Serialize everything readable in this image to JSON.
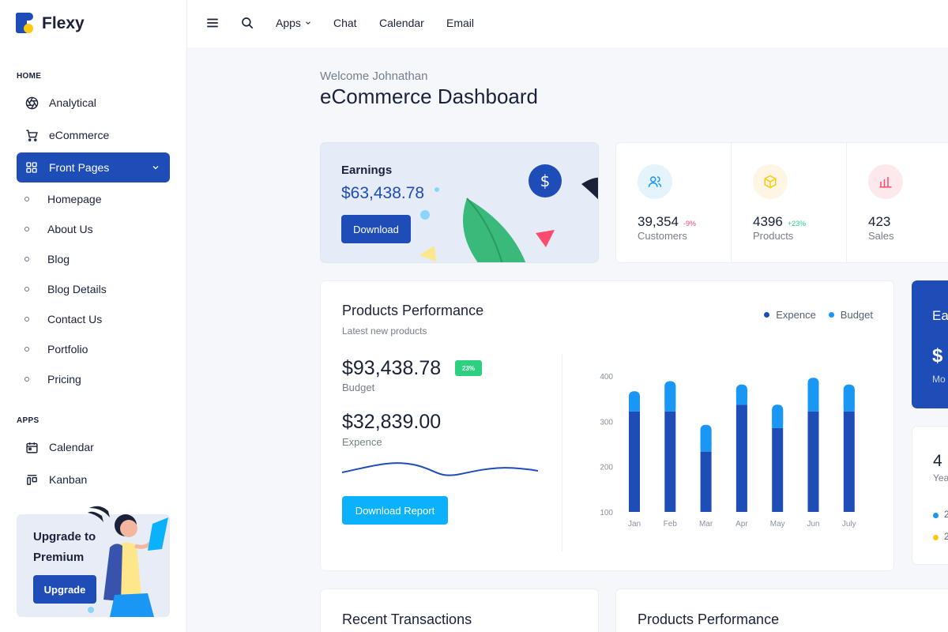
{
  "brand": {
    "name": "Flexy"
  },
  "sidebar": {
    "home_caption": "HOME",
    "apps_caption": "APPS",
    "items": [
      {
        "label": "Analytical",
        "icon": "aperture-icon"
      },
      {
        "label": "eCommerce",
        "icon": "cart-icon"
      },
      {
        "label": "Front Pages",
        "icon": "grid-icon",
        "active": true
      }
    ],
    "sub_items": [
      "Homepage",
      "About Us",
      "Blog",
      "Blog Details",
      "Contact Us",
      "Portfolio",
      "Pricing"
    ],
    "apps": [
      {
        "label": "Calendar",
        "icon": "calendar-icon"
      },
      {
        "label": "Kanban",
        "icon": "kanban-icon"
      }
    ],
    "promo": {
      "title": "Upgrade to Premium",
      "button": "Upgrade"
    }
  },
  "topbar": {
    "links": [
      "Apps",
      "Chat",
      "Calendar",
      "Email"
    ]
  },
  "header": {
    "welcome": "Welcome Johnathan",
    "title": "eCommerce Dashboard"
  },
  "earnings": {
    "label": "Earnings",
    "value": "$63,438.78",
    "button": "Download"
  },
  "stats": [
    {
      "value": "39,354",
      "change": "-9%",
      "label": "Customers",
      "color": "#1e4db7"
    },
    {
      "value": "4396",
      "change": "+23%",
      "label": "Products",
      "color": "#fdc90f"
    },
    {
      "value": "423",
      "change": "",
      "label": "Sales",
      "color": "#fc4b6c"
    }
  ],
  "performance": {
    "title": "Products Performance",
    "subtitle": "Latest new products",
    "budget_value": "$93,438.78",
    "budget_badge": "23%",
    "budget_label": "Budget",
    "expence_value": "$32,839.00",
    "expence_label": "Expence",
    "button": "Download Report",
    "legend": [
      {
        "name": "Expence",
        "color": "#1e4db7"
      },
      {
        "name": "Budget",
        "color": "#1a97f5"
      }
    ]
  },
  "chart_data": {
    "type": "bar",
    "stacked": true,
    "categories": [
      "Jan",
      "Feb",
      "Mar",
      "Apr",
      "May",
      "Jun",
      "July"
    ],
    "series": [
      {
        "name": "Expence",
        "values": [
          300,
          300,
          180,
          320,
          250,
          300,
          300
        ],
        "color": "#1e4db7"
      },
      {
        "name": "Budget",
        "values": [
          60,
          90,
          80,
          60,
          70,
          100,
          80
        ],
        "color": "#1a97f5"
      }
    ],
    "ylim": [
      100,
      400
    ],
    "yticks": [
      100,
      200,
      300,
      400
    ],
    "grid": false,
    "legend": "top-right"
  },
  "side_blue": {
    "title": "Ea",
    "value": "$",
    "sub": "Mo"
  },
  "side_white": {
    "value": "4",
    "sub": "Yea",
    "rows": [
      "2",
      "2"
    ]
  },
  "bottom": {
    "transactions_title": "Recent Transactions",
    "performance_title": "Products Performance"
  }
}
